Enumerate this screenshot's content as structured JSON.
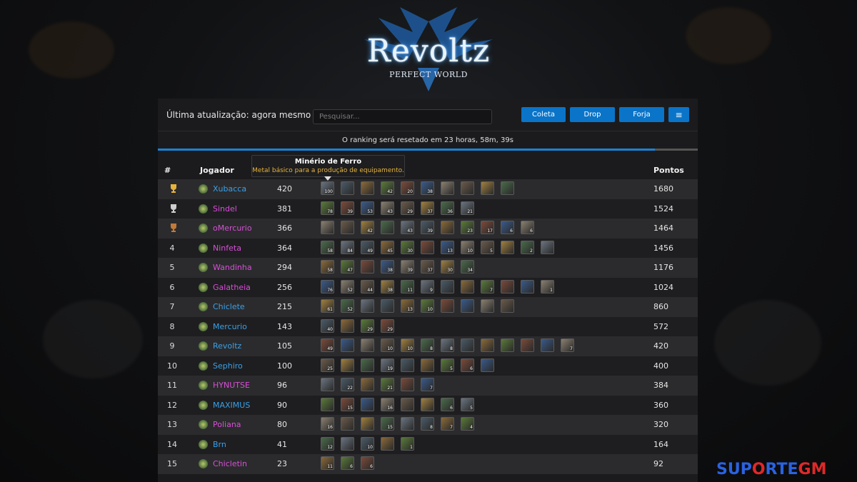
{
  "logo": {
    "title": "Revoltz",
    "subtitle": "PERFECT WORLD"
  },
  "header": {
    "last_update": "Última atualização: agora mesmo",
    "search_placeholder": "Pesquisar...",
    "buttons": {
      "coleta": "Coleta",
      "drop": "Drop",
      "forja": "Forja",
      "menu": "≡"
    }
  },
  "reset": {
    "text": "O ranking será resetado em 23 horas, 58m, 39s",
    "progress": 0.92
  },
  "table": {
    "col_rank": "#",
    "col_player": "Jogador",
    "col_points": "Pontos"
  },
  "tooltip": {
    "title": "Minério de Ferro",
    "description": "Metal básico para a produção de equipamento."
  },
  "colors": {
    "accent": "#0a74c8",
    "name_blue": "#3aa0e8",
    "name_pink": "#d84fd8",
    "gold": "#e8b33a"
  },
  "rows": [
    {
      "rank": "",
      "trophy": "gold",
      "name": "Xubacca",
      "name_color": "blue",
      "score": "420",
      "points": "1680",
      "items": [
        "100",
        "",
        "",
        "42",
        "20",
        "38",
        "",
        "",
        "",
        ""
      ]
    },
    {
      "rank": "",
      "trophy": "silver",
      "name": "Sindel",
      "name_color": "pink",
      "score": "381",
      "points": "1524",
      "items": [
        "78",
        "39",
        "53",
        "43",
        "29",
        "37",
        "36",
        "21"
      ]
    },
    {
      "rank": "",
      "trophy": "bronze",
      "name": "oMercurio",
      "name_color": "pink",
      "score": "366",
      "points": "1464",
      "items": [
        "",
        "",
        "42",
        "",
        "43",
        "39",
        "",
        "23",
        "17",
        "6",
        "6"
      ]
    },
    {
      "rank": "4",
      "trophy": "",
      "name": "Ninfeta",
      "name_color": "pink",
      "score": "364",
      "points": "1456",
      "items": [
        "58",
        "84",
        "49",
        "45",
        "30",
        "",
        "13",
        "10",
        "5",
        "",
        "2",
        ""
      ]
    },
    {
      "rank": "5",
      "trophy": "",
      "name": "Wandinha",
      "name_color": "pink",
      "score": "294",
      "points": "1176",
      "items": [
        "58",
        "47",
        "",
        "38",
        "39",
        "37",
        "30",
        "34"
      ]
    },
    {
      "rank": "6",
      "trophy": "",
      "name": "Galatheia",
      "name_color": "pink",
      "score": "256",
      "points": "1024",
      "items": [
        "76",
        "52",
        "44",
        "38",
        "11",
        "9",
        "",
        "",
        "7",
        "",
        "",
        "1"
      ]
    },
    {
      "rank": "7",
      "trophy": "",
      "name": "Chiclete",
      "name_color": "blue",
      "score": "215",
      "points": "860",
      "items": [
        "61",
        "52",
        "",
        "",
        "13",
        "10",
        "",
        "",
        "",
        ""
      ]
    },
    {
      "rank": "8",
      "trophy": "",
      "name": "Mercurio",
      "name_color": "blue",
      "score": "143",
      "points": "572",
      "items": [
        "40",
        "",
        "29",
        "29"
      ]
    },
    {
      "rank": "9",
      "trophy": "",
      "name": "Revoltz",
      "name_color": "blue",
      "score": "105",
      "points": "420",
      "items": [
        "49",
        "",
        "",
        "10",
        "10",
        "8",
        "8",
        "",
        "",
        "",
        "",
        "",
        "7"
      ]
    },
    {
      "rank": "10",
      "trophy": "",
      "name": "Sephiro",
      "name_color": "blue",
      "score": "100",
      "points": "400",
      "items": [
        "25",
        "",
        "",
        "19",
        "",
        "",
        "5",
        "6",
        ""
      ]
    },
    {
      "rank": "11",
      "trophy": "",
      "name": "HYNUTSE",
      "name_color": "pink",
      "score": "96",
      "points": "384",
      "items": [
        "",
        "22",
        "",
        "21",
        "",
        "7"
      ]
    },
    {
      "rank": "12",
      "trophy": "",
      "name": "MAXIMUS",
      "name_color": "blue",
      "score": "90",
      "points": "360",
      "items": [
        "",
        "15",
        "",
        "16",
        "",
        "",
        "6",
        "5"
      ]
    },
    {
      "rank": "13",
      "trophy": "",
      "name": "Poliana",
      "name_color": "pink",
      "score": "80",
      "points": "320",
      "items": [
        "16",
        "",
        "",
        "15",
        "",
        "8",
        "7",
        "4"
      ]
    },
    {
      "rank": "14",
      "trophy": "",
      "name": "Brn",
      "name_color": "blue",
      "score": "41",
      "points": "164",
      "items": [
        "12",
        "",
        "10",
        "",
        "1"
      ]
    },
    {
      "rank": "15",
      "trophy": "",
      "name": "Chicletin",
      "name_color": "pink",
      "score": "23",
      "points": "92",
      "items": [
        "11",
        "6",
        "6"
      ]
    }
  ],
  "watermark": {
    "part1": "SUP",
    "part2": "O",
    "part3": "RTE",
    "part4": "GM"
  }
}
